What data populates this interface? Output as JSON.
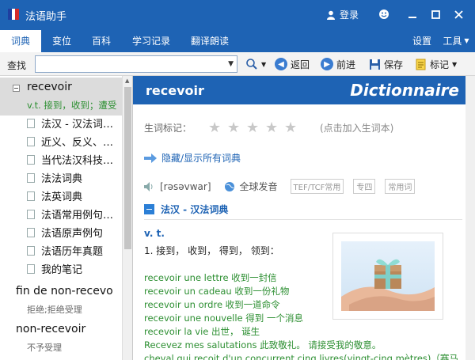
{
  "app": {
    "title": "法语助手",
    "login_label": "登录"
  },
  "tabs": [
    {
      "label": "词典",
      "active": true
    },
    {
      "label": "变位"
    },
    {
      "label": "百科"
    },
    {
      "label": "学习记录"
    },
    {
      "label": "翻译朗读"
    }
  ],
  "right_tabs": {
    "settings": "设置",
    "tools": "工具"
  },
  "toolbar": {
    "find_label": "查找",
    "search_value": "",
    "back_label": "返回",
    "forward_label": "前进",
    "save_label": "保存",
    "mark_label": "标记"
  },
  "sidebar": {
    "entry1": {
      "word": "recevoir",
      "gloss": "v.t. 接到，收到；遭受",
      "dicts": [
        "法汉 - 汉法词…",
        "近义、反义、…",
        "当代法汉科技…",
        "法法词典",
        "法英词典",
        "法语常用例句…",
        "法语原声例句",
        "法语历年真题",
        "我的笔记"
      ]
    },
    "entry2": {
      "word": "fin de non-recevo",
      "gloss": "拒绝;拒绝受理"
    },
    "entry3": {
      "word": "non-recevoir",
      "gloss": "不予受理"
    }
  },
  "main": {
    "word": "recevoir",
    "brand": "Dictionnaire",
    "mark_label": "生词标记：",
    "mark_hint": "(点击加入生词本)",
    "toggle_all": "隐藏/显示所有词典",
    "phonetic": "[rəsəvwar]",
    "global_audio": "全球发音",
    "tags": [
      "TEF/TCF常用",
      "专四",
      "常用词"
    ],
    "section_title": "法汉 - 汉法词典",
    "pos": "v. t.",
    "sense1": "1. 接到， 收到， 得到， 领到：",
    "examples": [
      "recevoir une lettre 收到一封信",
      "recevoir un cadeau 收到一份礼物",
      "recevoir un ordre 收到一道命令",
      "recevoir une nouvelle 得到 一个消息",
      "recevoir la vie 出世， 诞生",
      "Recevez mes salutations 此致敬礼。 请接受我的敬意。",
      "cheval qui reçoit d'un concurrent cinq livres(vingt-cinq mètres)（赛马"
    ]
  },
  "colors": {
    "brand_blue": "#1e63b4",
    "example_green": "#2d8f32"
  }
}
